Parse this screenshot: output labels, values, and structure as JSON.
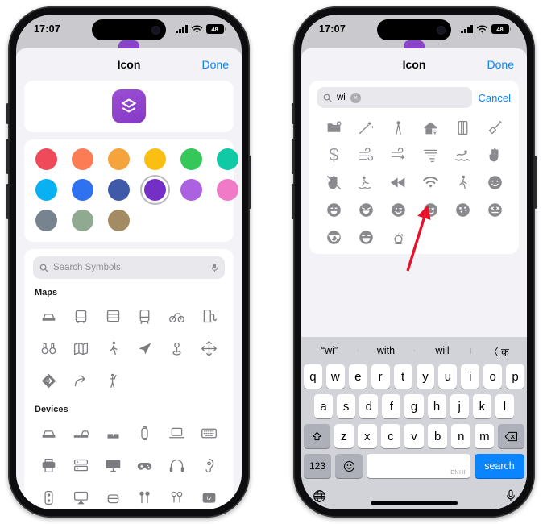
{
  "phones": [
    {
      "id": "left",
      "status": {
        "time": "17:07",
        "battery": "48"
      },
      "sheet": {
        "title": "Icon",
        "done_label": "Done"
      },
      "colors": {
        "selected_index": 9,
        "swatches": [
          "#ee4a5a",
          "#fc7d55",
          "#f5a33c",
          "#fbbf14",
          "#36c75b",
          "#10c9a5",
          "#09b0f2",
          "#2f72ef",
          "#3e5aa9",
          "#7430c6",
          "#ab61e0",
          "#f079c8",
          "#77838f",
          "#8faa90",
          "#a38b63"
        ]
      },
      "search": {
        "placeholder": "Search Symbols"
      },
      "sections": [
        {
          "title": "Maps",
          "rows": [
            [
              "car-icon",
              "bus-icon",
              "bus-doubledecker-icon",
              "tram-icon",
              "bicycle-icon",
              "fuelpump-icon"
            ],
            [
              "binoculars-icon",
              "map-icon",
              "figure-walk-icon",
              "location-arrow-icon",
              "mappin-icon",
              "arrow-move-icon"
            ],
            [
              "signpost-icon",
              "arrow-turn-right-icon",
              "figure-wave-icon"
            ]
          ]
        },
        {
          "title": "Devices",
          "rows": [
            [
              "car-side-icon",
              "car-two-icon",
              "car-charge-icon",
              "applewatch-icon",
              "laptop-icon",
              "keyboard-icon"
            ],
            [
              "printer-icon",
              "server-rack-icon",
              "display-icon",
              "gamecontroller-icon",
              "headphones-icon",
              "airpod-icon"
            ],
            [
              "homepod-icon",
              "airplay-icon",
              "earbuds-case-icon",
              "earbuds-icon",
              "airpods-pro-icon",
              "appletv-icon"
            ]
          ]
        }
      ]
    },
    {
      "id": "right",
      "status": {
        "time": "17:07",
        "battery": "48"
      },
      "sheet": {
        "title": "Icon",
        "done_label": "Done"
      },
      "search": {
        "value": "wi",
        "cancel_label": "Cancel",
        "clear_label": "×"
      },
      "results": [
        [
          "folder-gear-icon",
          "wand-sparkles-icon",
          "compass-drafting-icon",
          "house-wifi-icon",
          "book-closed-icon",
          "syringe-icon"
        ],
        [
          "dollarsign-icon",
          "wind-icon",
          "wind-snow-icon",
          "tornado-icon",
          "figure-swim-icon",
          "hand-raised-icon"
        ],
        [
          "hand-raised-slash-icon",
          "figure-waterski-icon",
          "backward-icon",
          "wifi-icon",
          "figure-walk-icon",
          "face-smiling-icon"
        ],
        [
          "face-grin-icon",
          "face-laugh-icon",
          "face-wink-icon",
          "face-star-eyes-icon",
          "face-artist-icon",
          "face-dizzy-icon"
        ],
        [
          "face-sunglasses-icon",
          "face-grin-wide-icon",
          "face-unicorn-icon"
        ]
      ],
      "keyboard": {
        "predictions": [
          "“wi”",
          "with",
          "will",
          "〈 क"
        ],
        "row1": [
          "q",
          "w",
          "e",
          "r",
          "t",
          "y",
          "u",
          "i",
          "o",
          "p"
        ],
        "row2": [
          "a",
          "s",
          "d",
          "f",
          "g",
          "h",
          "j",
          "k",
          "l"
        ],
        "row3": [
          "z",
          "x",
          "c",
          "v",
          "b",
          "n",
          "m"
        ],
        "shift_label": "shift-icon",
        "delete_label": "delete-icon",
        "numeric_label": "123",
        "emoji_label": "emoji-icon",
        "space_hint": "ENHI",
        "return_label": "search",
        "globe_label": "globe-icon",
        "mic_label": "mic-icon"
      }
    }
  ],
  "annotation": {
    "arrow_color": "#e8122a",
    "points_to": "wifi-icon"
  }
}
